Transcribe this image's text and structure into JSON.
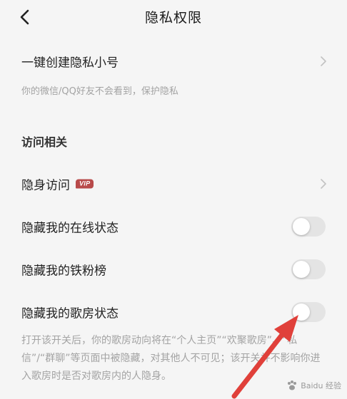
{
  "header": {
    "title": "隐私权限",
    "back_icon": "back-chevron-icon"
  },
  "create_alias": {
    "label": "一键创建隐私小号",
    "description": "你的微信/QQ好友不会看到，保护隐私"
  },
  "section": {
    "title": "访问相关"
  },
  "invisible_visit": {
    "label": "隐身访问",
    "badge": "VIP"
  },
  "toggles": [
    {
      "label": "隐藏我的在线状态",
      "enabled": false
    },
    {
      "label": "隐藏我的铁粉榜",
      "enabled": false
    },
    {
      "label": "隐藏我的歌房状态",
      "enabled": false
    }
  ],
  "song_room_description": "打开该开关后，你的歌房动向将在“个人主页”“欢聚歌房”、“私信”/“群聊”等页面中被隐藏，对其他人不可见；该开关并不影响你进入歌房时是否对歌房内的人隐身。",
  "watermark": {
    "text": "Baidu 经验"
  },
  "colors": {
    "background": "#f5f5f5",
    "toggle_off": "#e4e4e4",
    "vip_badge": "#b84a4a",
    "annotation_arrow": "#e0403a",
    "secondary_text": "#a3a3a3"
  }
}
